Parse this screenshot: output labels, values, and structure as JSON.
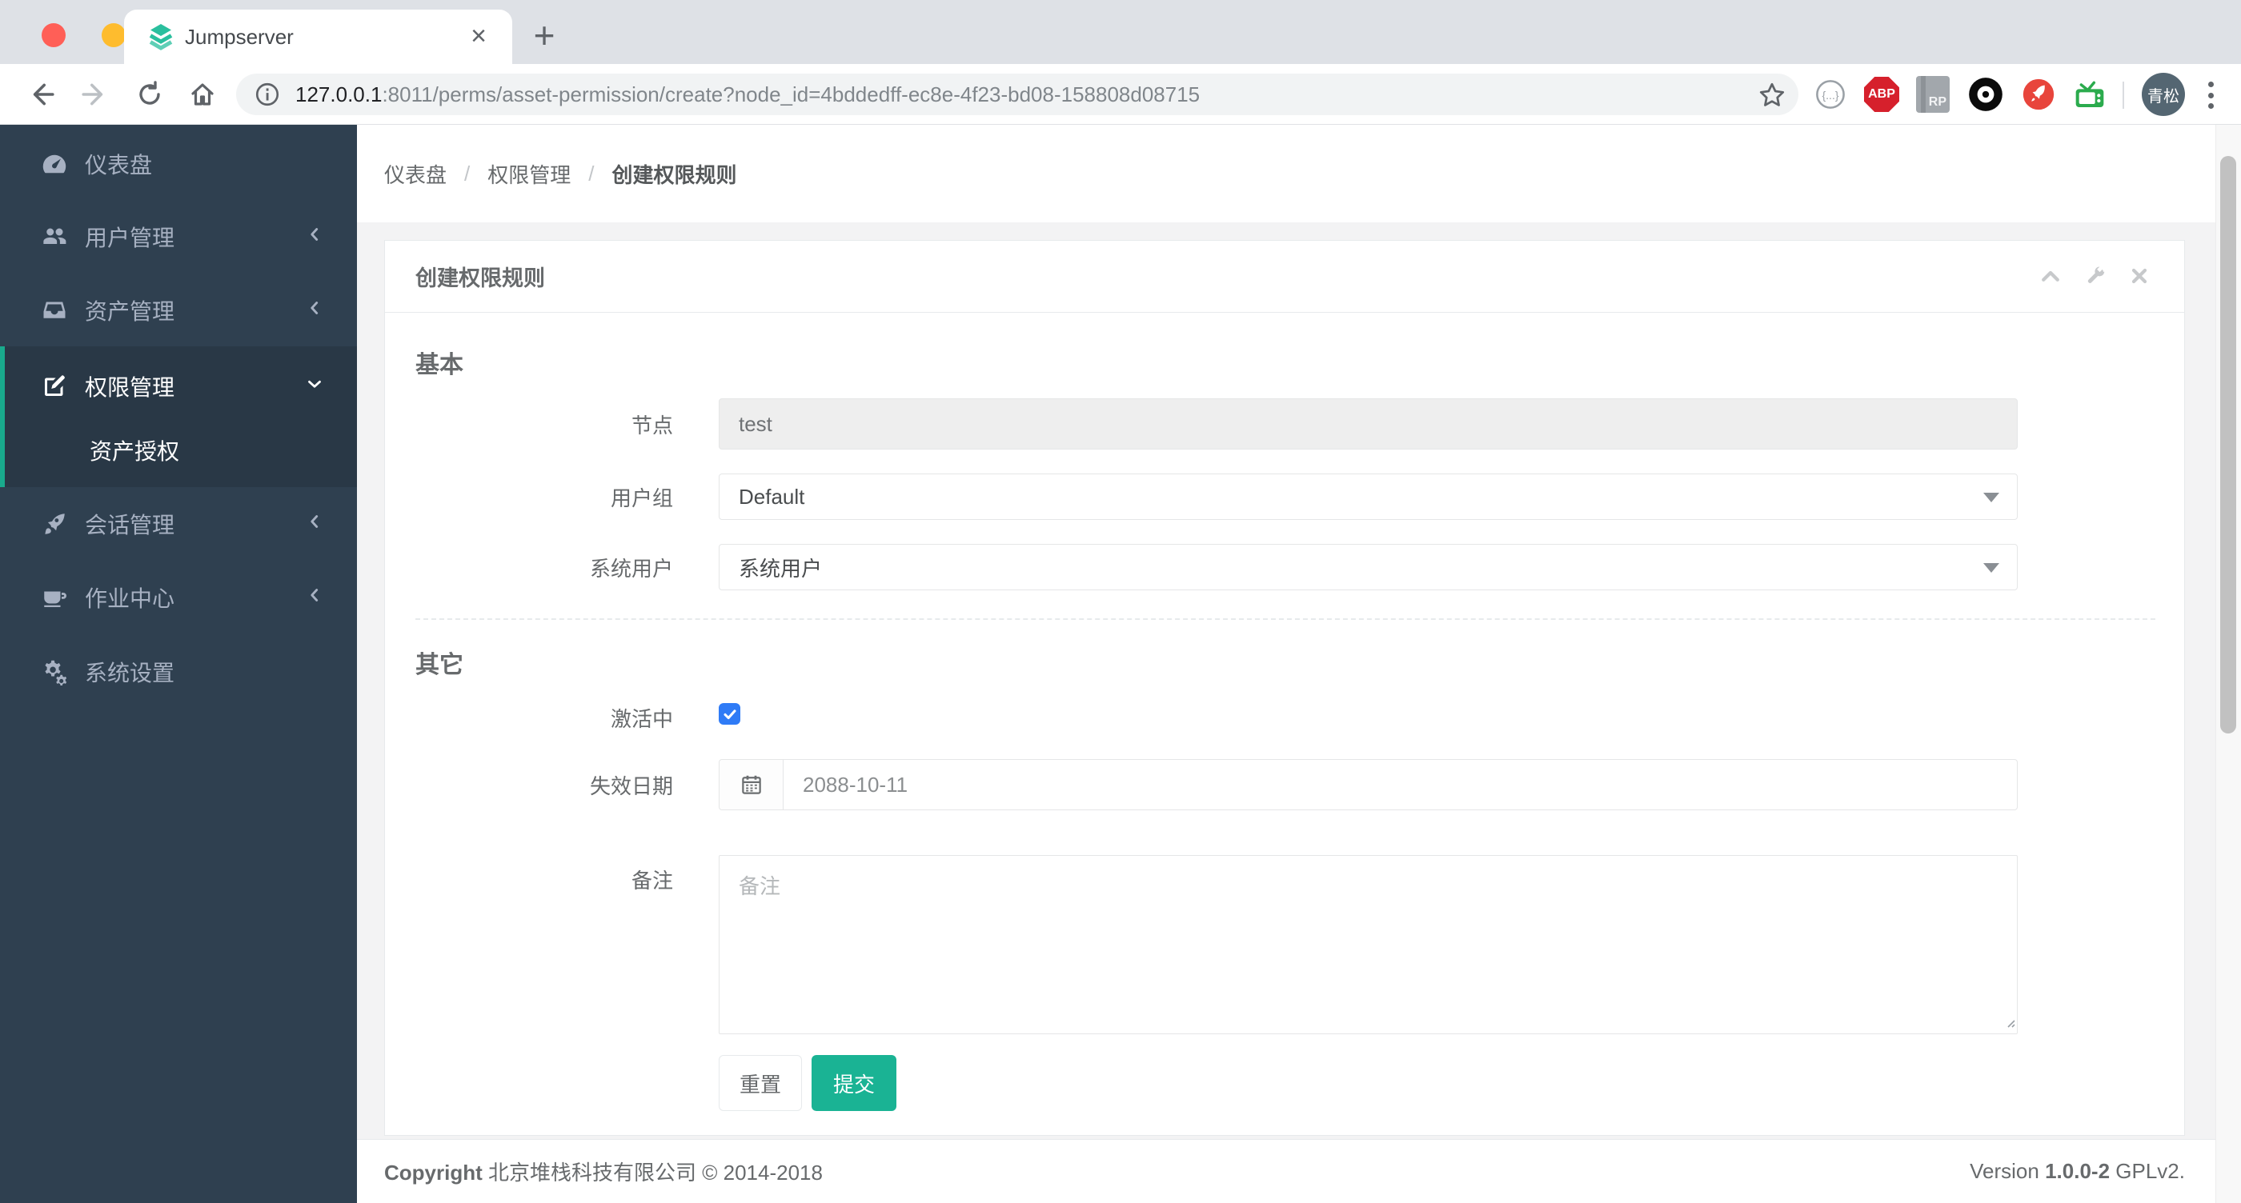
{
  "browser": {
    "tab_title": "Jumpserver",
    "tab_close": "×",
    "new_tab": "+",
    "url_host": "127.0.0.1",
    "url_rest": ":8011/perms/asset-permission/create?node_id=4bddedff-ec8e-4f23-bd08-158808d08715",
    "ext_abp": "ABP",
    "ext_rp": "RP",
    "profile_initials": "青松",
    "traffic_colors": {
      "close": "#ff5f57",
      "minimize": "#febc2e",
      "zoom": "#28c840"
    }
  },
  "sidebar": {
    "items": [
      {
        "label": "仪表盘",
        "icon": "dashboard-icon"
      },
      {
        "label": "用户管理",
        "icon": "users-icon",
        "chevron": "left"
      },
      {
        "label": "资产管理",
        "icon": "inbox-icon",
        "chevron": "left"
      },
      {
        "label": "权限管理",
        "icon": "edit-icon",
        "chevron": "down",
        "active": true
      },
      {
        "label": "资产授权",
        "submenu_of": "权限管理",
        "active": true
      },
      {
        "label": "会话管理",
        "icon": "rocket-icon",
        "chevron": "left"
      },
      {
        "label": "作业中心",
        "icon": "coffee-icon",
        "chevron": "left"
      },
      {
        "label": "系统设置",
        "icon": "gears-icon"
      }
    ],
    "accent_color": "#19aa8d",
    "bg_color": "#2f4050",
    "active_bg_color": "#293846"
  },
  "breadcrumb": {
    "items": [
      "仪表盘",
      "权限管理",
      "创建权限规则"
    ],
    "separator": "/"
  },
  "panel": {
    "title": "创建权限规则"
  },
  "form": {
    "section_basic": "基本",
    "node_label": "节点",
    "node_value": "test",
    "usergroup_label": "用户组",
    "usergroup_value": "Default",
    "sysuser_label": "系统用户",
    "sysuser_value": "系统用户",
    "section_other": "其它",
    "active_label": "激活中",
    "active_checked": true,
    "expire_label": "失效日期",
    "expire_value": "2088-10-11",
    "comment_label": "备注",
    "comment_placeholder": "备注",
    "reset_button": "重置",
    "submit_button": "提交",
    "submit_color": "#1ab394"
  },
  "footer": {
    "copyright_bold": "Copyright",
    "copyright_rest": "北京堆栈科技有限公司 © 2014-2018",
    "version_prefix": "Version",
    "version_number": "1.0.0-2",
    "version_suffix": "GPLv2."
  }
}
